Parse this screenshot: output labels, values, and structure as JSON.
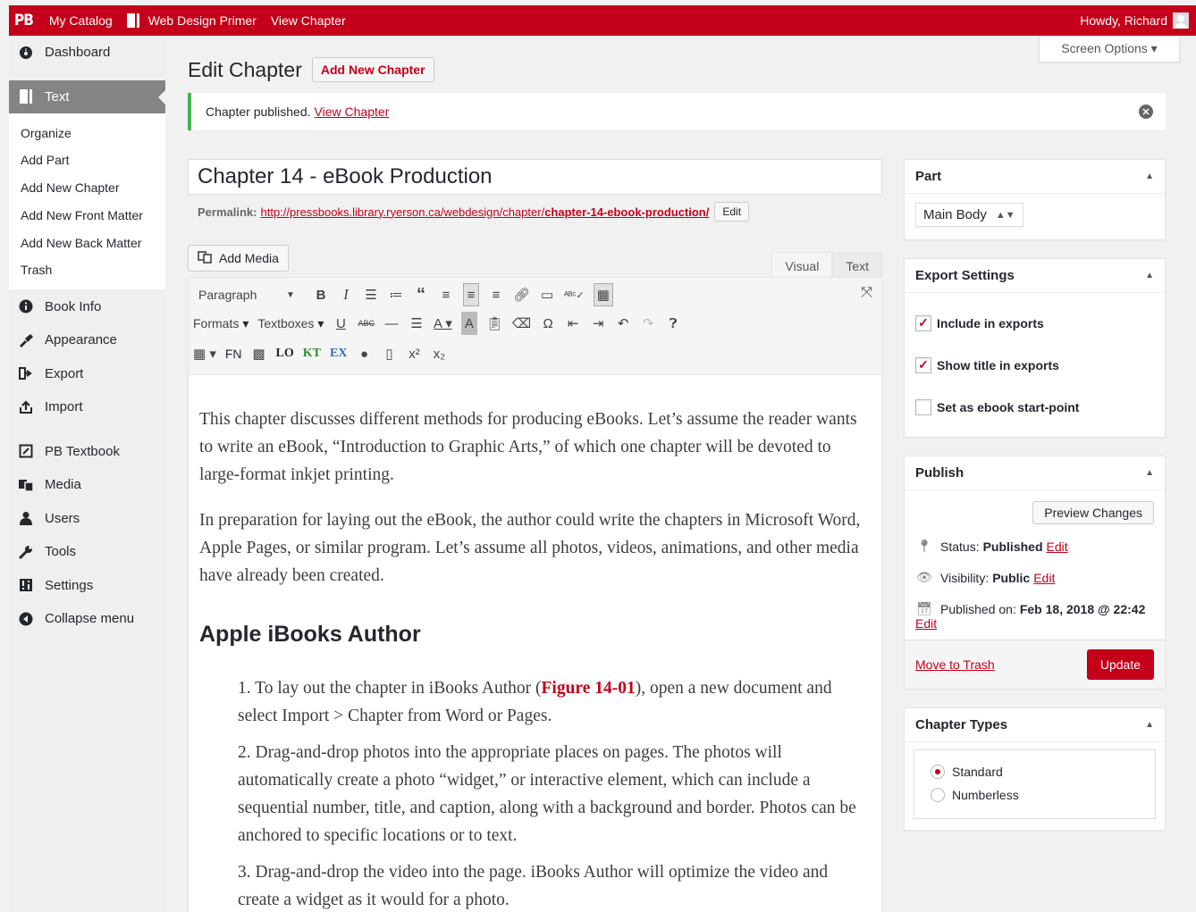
{
  "topbar": {
    "logo": "PB",
    "my_catalog": "My Catalog",
    "book_title": "Web Design Primer",
    "view_chapter": "View Chapter",
    "greeting": "Howdy, Richard"
  },
  "sidebar": {
    "dashboard": "Dashboard",
    "text": "Text",
    "submenu": [
      "Organize",
      "Add Part",
      "Add New Chapter",
      "Add New Front Matter",
      "Add New Back Matter",
      "Trash"
    ],
    "book_info": "Book Info",
    "appearance": "Appearance",
    "export": "Export",
    "import": "Import",
    "pb_textbook": "PB Textbook",
    "media": "Media",
    "users": "Users",
    "tools": "Tools",
    "settings": "Settings",
    "collapse": "Collapse menu"
  },
  "header": {
    "title": "Edit Chapter",
    "add_new": "Add New Chapter",
    "screen_options": "Screen Options ▾"
  },
  "notice": {
    "text": "Chapter published.",
    "link": "View Chapter"
  },
  "chapter": {
    "title": "Chapter 14 - eBook Production",
    "permalink_label": "Permalink:",
    "permalink_base": "http://pressbooks.library.ryerson.ca/webdesign/chapter/",
    "permalink_slug": "chapter-14-ebook-production/",
    "edit_button": "Edit"
  },
  "editor": {
    "add_media": "Add Media",
    "tab_visual": "Visual",
    "tab_text": "Text",
    "format_select": "Paragraph",
    "formats": "Formats",
    "textboxes": "Textboxes",
    "fn": "FN",
    "lo": "LO",
    "kt": "KT",
    "ex": "EX",
    "para1": "This chapter discusses different methods for producing eBooks. Let’s assume the reader wants to write an eBook, “Introduction to Graphic Arts,” of which one chapter will be devoted to large-format inkjet printing.",
    "para2": "In preparation for laying out the eBook, the author could write the chapters in Microsoft Word, Apple Pages, or similar program. Let’s assume all photos, videos, animations, and other media have already been created.",
    "heading": "Apple iBooks Author",
    "li1_a": "1. To lay out the chapter in iBooks Author (",
    "li1_fig": "Figure 14-01",
    "li1_b": "), open a new document and select Import > Chapter from Word or Pages.",
    "li2": "2. Drag-and-drop photos into the appropriate places on pages. The photos will automatically create a photo “widget,” or interactive element, which can include a sequential number, title, and caption, along with a background and border. Photos can be anchored to specific locations or to text.",
    "li3": "3. Drag-and-drop the video into the page. iBooks Author will optimize the video and create a widget as it would for a photo."
  },
  "part_box": {
    "title": "Part",
    "value": "Main Body"
  },
  "export_box": {
    "title": "Export Settings",
    "include": "Include in exports",
    "show_title": "Show title in exports",
    "start_point": "Set as ebook start-point"
  },
  "publish_box": {
    "title": "Publish",
    "preview": "Preview Changes",
    "status_label": "Status:",
    "status_value": "Published",
    "visibility_label": "Visibility:",
    "visibility_value": "Public",
    "published_label": "Published on:",
    "published_value": "Feb 18, 2018 @ 22:42",
    "edit": "Edit",
    "trash": "Move to Trash",
    "update": "Update"
  },
  "types_box": {
    "title": "Chapter Types",
    "standard": "Standard",
    "numberless": "Numberless"
  },
  "colors": {
    "brand": "#c4001a",
    "notice_border": "#46b450"
  }
}
